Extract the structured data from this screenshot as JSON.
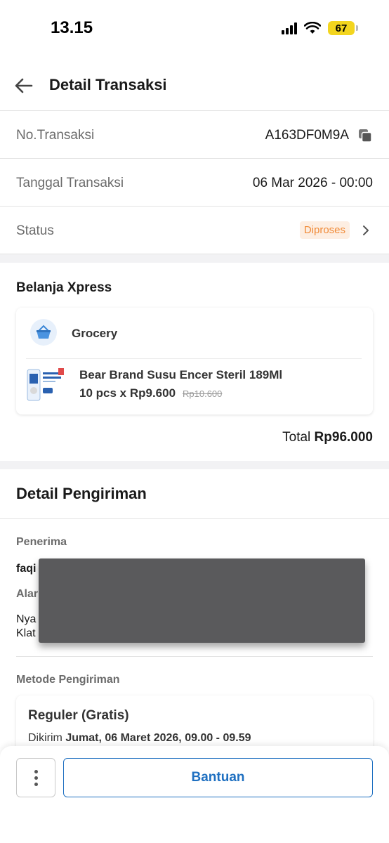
{
  "status_bar": {
    "time": "13.15",
    "battery": "67"
  },
  "header": {
    "title": "Detail Transaksi"
  },
  "transaction": {
    "no_label": "No.Transaksi",
    "no_value": "A163DF0M9A",
    "date_label": "Tanggal Transaksi",
    "date_value": "06 Mar 2026 - 00:00",
    "status_label": "Status",
    "status_value": "Diproses"
  },
  "order": {
    "section_title": "Belanja Xpress",
    "category": "Grocery",
    "product_name": "Bear Brand Susu Encer Steril 189Ml",
    "product_qty": "10 pcs x Rp9.600",
    "product_old_price": "Rp10.600",
    "total_label": "Total",
    "total_value": "Rp96.000"
  },
  "shipping": {
    "title": "Detail Pengiriman",
    "receiver_label": "Penerima",
    "receiver_value": "faqi",
    "address_label": "Alar",
    "address_line1": "Nya",
    "address_line2": "Klat",
    "method_label": "Metode Pengiriman",
    "method_title": "Reguler (Gratis)",
    "sent_prefix": "Dikirim",
    "sent_value": "Jumat, 06 Maret 2026, 09.00 - 09.59"
  },
  "footer": {
    "help_label": "Bantuan"
  },
  "colors": {
    "accent": "#1f70c1",
    "status_bg": "#fdeee2",
    "status_text": "#f08a37",
    "battery": "#f3d51f"
  }
}
